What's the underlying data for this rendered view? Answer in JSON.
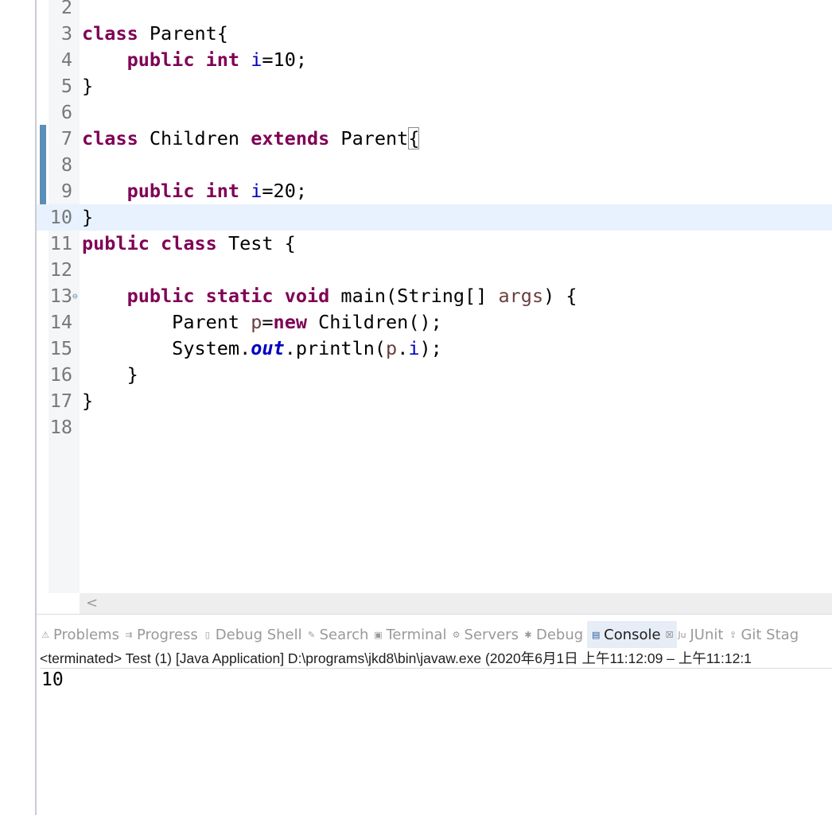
{
  "editor": {
    "lines": [
      {
        "n": "2",
        "tokens": []
      },
      {
        "n": "3",
        "tokens": [
          [
            "kw",
            "class"
          ],
          [
            "p",
            " Parent{"
          ]
        ]
      },
      {
        "n": "4",
        "tokens": [
          [
            "p",
            "    "
          ],
          [
            "kw",
            "public"
          ],
          [
            "p",
            " "
          ],
          [
            "kw",
            "int"
          ],
          [
            "p",
            " "
          ],
          [
            "fld",
            "i"
          ],
          [
            "p",
            "=10;"
          ]
        ]
      },
      {
        "n": "5",
        "tokens": [
          [
            "p",
            "}"
          ]
        ]
      },
      {
        "n": "6",
        "tokens": []
      },
      {
        "n": "7",
        "tokens": [
          [
            "kw",
            "class"
          ],
          [
            "p",
            " Children "
          ],
          [
            "kw",
            "extends"
          ],
          [
            "p",
            " Parent"
          ],
          [
            "brk",
            "{"
          ]
        ]
      },
      {
        "n": "8",
        "tokens": []
      },
      {
        "n": "9",
        "tokens": [
          [
            "p",
            "    "
          ],
          [
            "kw",
            "public"
          ],
          [
            "p",
            " "
          ],
          [
            "kw",
            "int"
          ],
          [
            "p",
            " "
          ],
          [
            "fld",
            "i"
          ],
          [
            "p",
            "=20;"
          ]
        ]
      },
      {
        "n": "10",
        "tokens": [
          [
            "p",
            "}"
          ]
        ],
        "current": true
      },
      {
        "n": "11",
        "tokens": [
          [
            "kw",
            "public"
          ],
          [
            "p",
            " "
          ],
          [
            "kw",
            "class"
          ],
          [
            "p",
            " Test {"
          ]
        ]
      },
      {
        "n": "12",
        "tokens": []
      },
      {
        "n": "13",
        "fold": "⊖",
        "tokens": [
          [
            "p",
            "    "
          ],
          [
            "kw",
            "public"
          ],
          [
            "p",
            " "
          ],
          [
            "kw",
            "static"
          ],
          [
            "p",
            " "
          ],
          [
            "kw",
            "void"
          ],
          [
            "p",
            " main(String[] "
          ],
          [
            "var",
            "args"
          ],
          [
            "p",
            ") {"
          ]
        ]
      },
      {
        "n": "14",
        "tokens": [
          [
            "p",
            "        Parent "
          ],
          [
            "var",
            "p"
          ],
          [
            "p",
            "="
          ],
          [
            "kw",
            "new"
          ],
          [
            "p",
            " Children();"
          ]
        ]
      },
      {
        "n": "15",
        "tokens": [
          [
            "p",
            "        System."
          ],
          [
            "sfld",
            "out"
          ],
          [
            "p",
            ".println("
          ],
          [
            "var",
            "p"
          ],
          [
            "p",
            "."
          ],
          [
            "fld",
            "i"
          ],
          [
            "p",
            ");"
          ]
        ]
      },
      {
        "n": "16",
        "tokens": [
          [
            "p",
            "    }"
          ]
        ]
      },
      {
        "n": "17",
        "tokens": [
          [
            "p",
            "}"
          ]
        ]
      },
      {
        "n": "18",
        "tokens": []
      }
    ],
    "scroll_left_icon": "scroll-left-arrow"
  },
  "panel": {
    "tabs": [
      {
        "label": "Problems",
        "icon": "problems-icon",
        "glyph": "⚠"
      },
      {
        "label": "Progress",
        "icon": "progress-icon",
        "glyph": "⇉"
      },
      {
        "label": "Debug Shell",
        "icon": "debug-shell-icon",
        "glyph": "▯"
      },
      {
        "label": "Search",
        "icon": "search-icon",
        "glyph": "✎"
      },
      {
        "label": "Terminal",
        "icon": "terminal-icon",
        "glyph": "▣"
      },
      {
        "label": "Servers",
        "icon": "servers-icon",
        "glyph": "⚙"
      },
      {
        "label": "Debug",
        "icon": "debug-icon",
        "glyph": "✱"
      },
      {
        "label": "Console",
        "icon": "console-icon",
        "glyph": "▤",
        "active": true,
        "close": "☒"
      },
      {
        "label": "JUnit",
        "icon": "junit-icon",
        "glyph": "Ju"
      },
      {
        "label": "Git Stag",
        "icon": "git-staging-icon",
        "glyph": "⇪"
      }
    ],
    "status": "<terminated> Test (1) [Java Application] D:\\programs\\jkd8\\bin\\javaw.exe  (2020年6月1日 上午11:12:09 – 上午11:12:1",
    "output": "10"
  },
  "colors": {
    "keyword": "#7f0055",
    "field": "#0000c0",
    "local_variable": "#6a3e3e",
    "current_line": "#e8f2fe"
  }
}
